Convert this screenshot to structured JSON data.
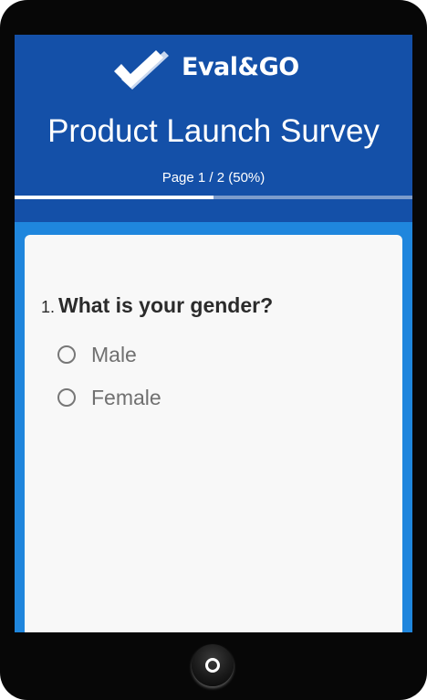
{
  "brand": {
    "name": "Eval&GO",
    "logo_icon": "checkmark-icon"
  },
  "survey": {
    "title": "Product Launch Survey",
    "page_indicator": "Page 1 / 2  (50%)",
    "progress_percent": 50
  },
  "question": {
    "number": "1.",
    "text": "What is your gender?",
    "options": [
      {
        "label": "Male",
        "selected": false
      },
      {
        "label": "Female",
        "selected": false
      }
    ]
  },
  "colors": {
    "header_blue": "#1450a8",
    "accent_blue": "#1f86dd",
    "device_black": "#070707",
    "card_background": "#f8f8f8"
  }
}
